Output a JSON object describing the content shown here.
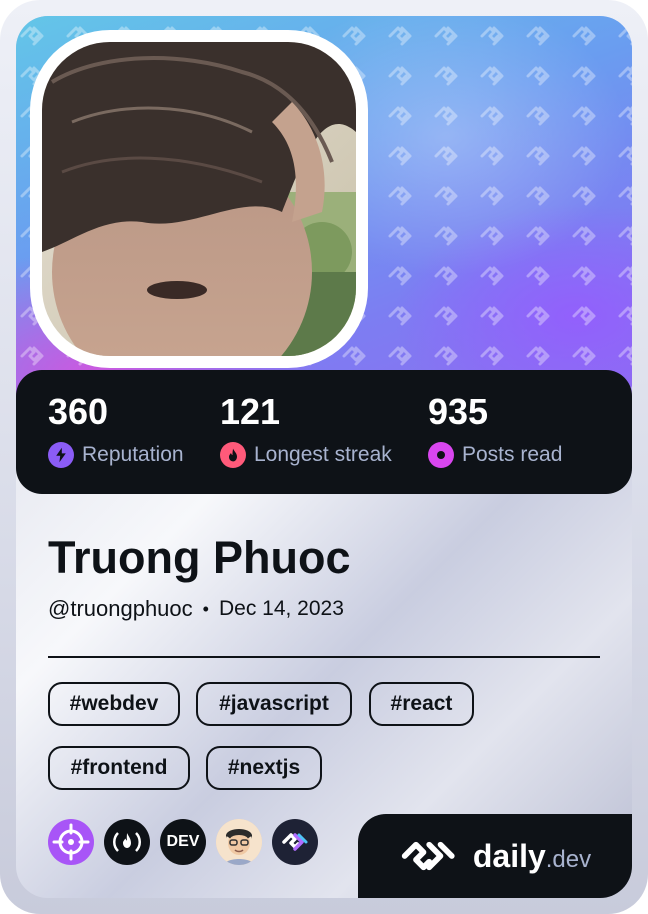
{
  "profile": {
    "name": "Truong Phuoc",
    "handle": "@truongphuoc",
    "separator": "•",
    "joined": "Dec 14, 2023"
  },
  "stats": [
    {
      "value": "360",
      "label": "Reputation",
      "icon": "lightning-icon",
      "color": "#8b5cf6"
    },
    {
      "value": "121",
      "label": "Longest streak",
      "icon": "flame-icon",
      "color": "#ff5a7a"
    },
    {
      "value": "935",
      "label": "Posts read",
      "icon": "eye-ring-icon",
      "color": "#d946ef"
    }
  ],
  "tags": [
    "#webdev",
    "#javascript",
    "#react",
    "#frontend",
    "#nextjs"
  ],
  "badges": [
    {
      "icon": "crosshair-squad-icon",
      "bg": "#a855f7"
    },
    {
      "icon": "freecodecamp-icon",
      "bg": "#0e1217"
    },
    {
      "text": "DEV",
      "bg": "#0e1217"
    },
    {
      "icon": "memoji-avatar-icon",
      "bg": "#f2d3b0"
    },
    {
      "icon": "daily-dev-squad-icon",
      "bg": "#1e2235"
    }
  ],
  "brand": {
    "name": "daily",
    "suffix": ".dev"
  }
}
